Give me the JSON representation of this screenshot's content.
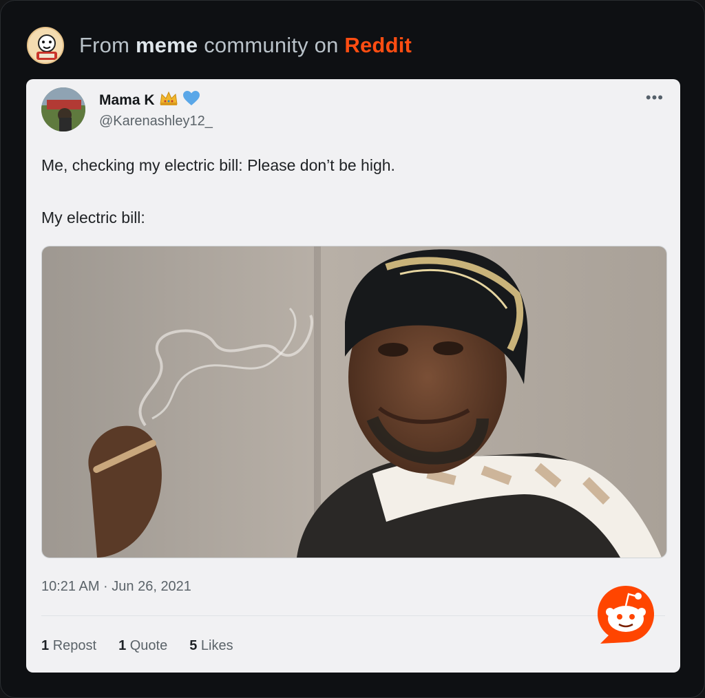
{
  "header": {
    "prefix": "From",
    "community": "meme",
    "middle": "community on",
    "platform": "Reddit",
    "avatar_icon": "meme-community-avatar-icon"
  },
  "tweet": {
    "author_name": "Mama K",
    "verified_badges": [
      "crown-emoji",
      "blue-heart-emoji"
    ],
    "handle": "@Karenashley12_",
    "line1": "Me, checking my electric bill: Please don’t be high.",
    "line2": "My electric bill:",
    "timestamp": "10:21 AM · Jun 26, 2021",
    "reposts_count": "1",
    "reposts_label": "Repost",
    "quotes_count": "1",
    "quotes_label": "Quote",
    "likes_count": "5",
    "likes_label": "Likes",
    "more_icon": "more-options-icon"
  },
  "colors": {
    "reddit_orange": "#ff4d12",
    "card_bg": "#f1f1f3",
    "page_bg": "#0e1013"
  }
}
